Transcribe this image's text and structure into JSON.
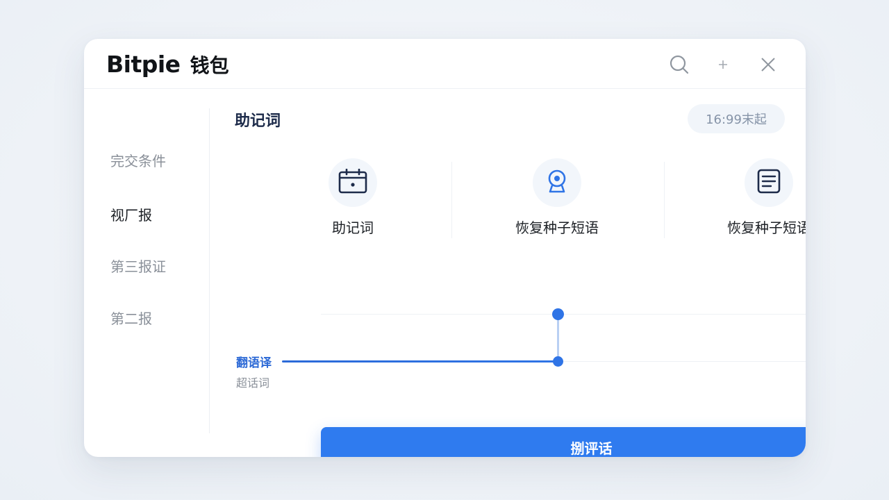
{
  "header": {
    "brand_name": "Bitpie",
    "brand_sub": "钱包",
    "icons": [
      "search-icon",
      "plus-icon",
      "close-icon"
    ]
  },
  "sidebar": {
    "items": [
      {
        "label": "完交条件",
        "active": false
      },
      {
        "label": "视厂报",
        "active": true
      },
      {
        "label": "第三报证",
        "active": false
      },
      {
        "label": "第二报",
        "active": false
      }
    ]
  },
  "main": {
    "title": "助记词",
    "badge": "16:99末起",
    "options": [
      {
        "label": "助记词",
        "icon": "calendar-icon"
      },
      {
        "label": "恢复种子短语",
        "icon": "webcam-icon"
      },
      {
        "label": "恢复种子短语",
        "icon": "document-icon"
      }
    ],
    "slider": {
      "label": "翻语译",
      "sublabel": "超话词"
    },
    "button_label": "捌评话"
  },
  "colors": {
    "accent": "#2f7bef",
    "title": "#1d2b4a",
    "muted": "#8a9099"
  }
}
